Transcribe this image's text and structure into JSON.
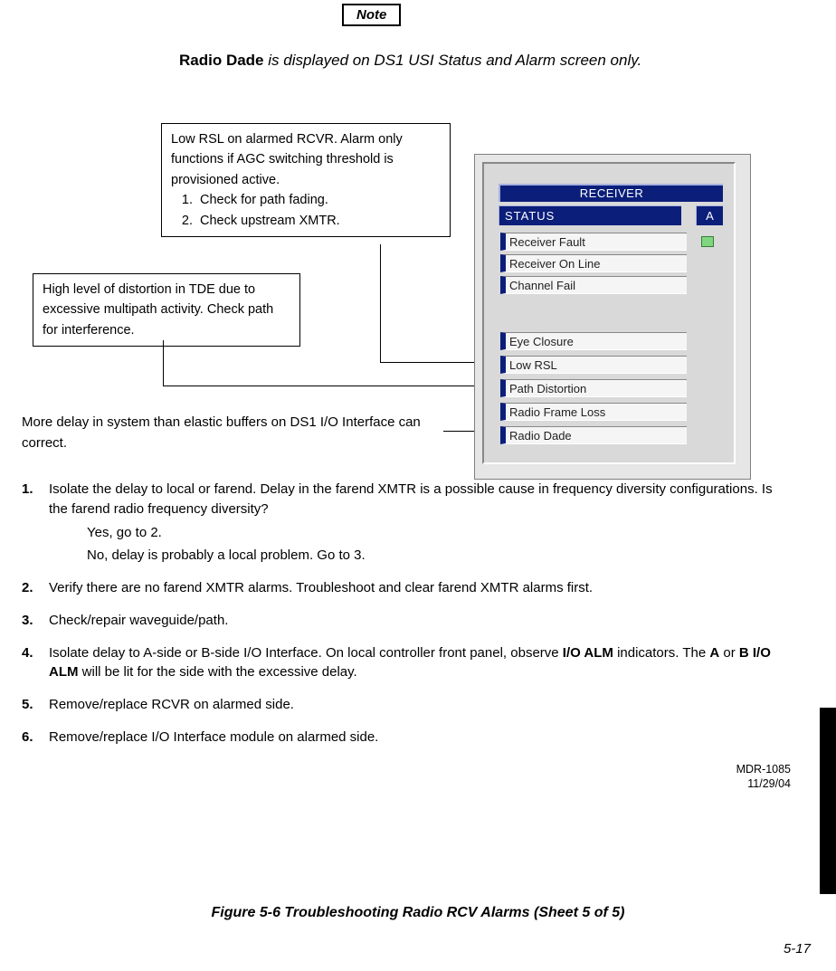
{
  "note_label": "Note",
  "note_text_bold": "Radio Dade",
  "note_text_rest": " is displayed on DS1 USI Status and Alarm screen only.",
  "callout1": {
    "intro": "Low RSL on alarmed RCVR. Alarm only functions if AGC switching threshold is provisioned active.",
    "item1": "Check for path fading.",
    "item2": "Check upstream XMTR."
  },
  "callout2": "High level of distortion in TDE due to excessive multipath activity. Check path for interference.",
  "more_delay": "More delay in system than elastic buffers on DS1 I/O Interface can correct.",
  "steps": {
    "s1a": "Isolate the delay to local or farend. Delay in the farend XMTR is a possible cause in frequency diversity configurations. Is the farend radio frequency diversity?",
    "s1_yes": "Yes, go to 2.",
    "s1_no": "No, delay is probably a local problem. Go to 3.",
    "s2": "Verify there are no farend XMTR alarms. Troubleshoot and clear farend XMTR alarms first.",
    "s3": "Check/repair waveguide/path.",
    "s4a": "Isolate delay to A-side or B-side I/O Interface. On local controller front panel, observe ",
    "s4b": "I/O ALM",
    "s4c": " indicators. The ",
    "s4d": "A",
    "s4e": " or ",
    "s4f": "B I/O ALM",
    "s4g": " will be lit for the side with the excessive delay.",
    "s5": "Remove/replace RCVR on alarmed side.",
    "s6": "Remove/replace I/O Interface module on alarmed side."
  },
  "panel": {
    "header": "RECEIVER",
    "status": "STATUS",
    "col": "A",
    "items": {
      "receiver_fault": "Receiver Fault",
      "receiver_online": "Receiver On Line",
      "channel_fail": "Channel Fail",
      "eye_closure": "Eye Closure",
      "low_rsl": "Low RSL",
      "path_distortion": "Path Distortion",
      "radio_frame_loss": "Radio Frame Loss",
      "radio_dade": "Radio Dade"
    }
  },
  "doc_id_line1": "MDR-1085",
  "doc_id_line2": "11/29/04",
  "figure_caption": "Figure 5-6  Troubleshooting Radio RCV Alarms (Sheet 5 of 5)",
  "page_num": "5-17"
}
